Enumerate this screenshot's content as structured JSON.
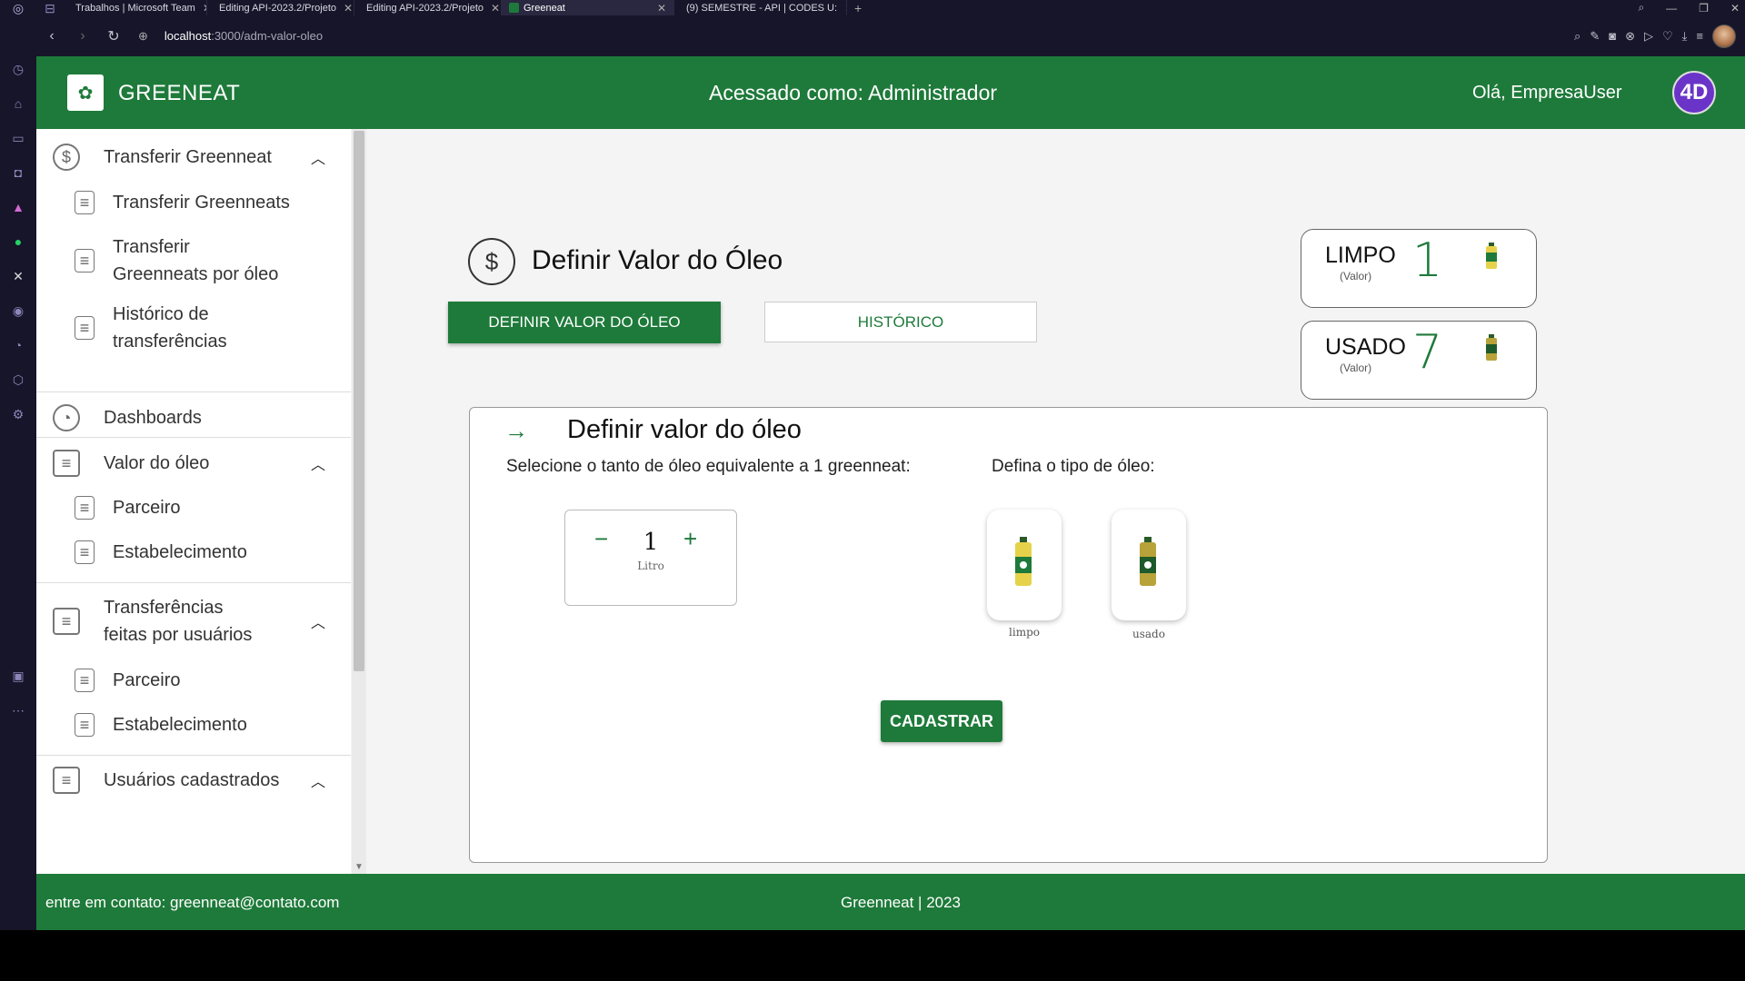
{
  "browser": {
    "tabs": [
      {
        "label": "Trabalhos | Microsoft Team",
        "color": "#5b5fc7"
      },
      {
        "label": "Editing API-2023.2/Projeto",
        "color": "#ffffff"
      },
      {
        "label": "Editing API-2023.2/Projeto",
        "color": "#ffffff"
      },
      {
        "label": "Greeneat",
        "color": "#1e7a3a"
      },
      {
        "label": "(9) SEMESTRE - API | CODES U:",
        "color": "#7b5cff"
      }
    ],
    "url_host": "localhost",
    "url_path": ":3000/adm-valor-oleo"
  },
  "header": {
    "brand": "GREENEAT",
    "access_text": "Acessado como: Administrador",
    "greeting": "Olá, EmpresaUser",
    "avatar_initials": "4D",
    "color": "#1e7a3a"
  },
  "sidebar": {
    "transferir_group": "Transferir Greenneat",
    "transferir_items": [
      "Transferir Greenneats",
      "Transferir Greenneats por óleo",
      "Histórico de transferências"
    ],
    "dashboards": "Dashboards",
    "valor_group": "Valor do óleo",
    "valor_items": [
      "Parceiro",
      "Estabelecimento"
    ],
    "transf_users_group": "Transferências feitas por usuários",
    "transf_users_items": [
      "Parceiro",
      "Estabelecimento"
    ],
    "usuarios_group": "Usuários cadastrados"
  },
  "main": {
    "page_title": "Definir Valor do Óleo",
    "tab_define": "DEFINIR VALOR DO ÓLEO",
    "tab_history": "HISTÓRICO",
    "value_cards": [
      {
        "name": "LIMPO",
        "sub": "(Valor)",
        "value": "1",
        "bottle": "clean"
      },
      {
        "name": "USADO",
        "sub": "(Valor)",
        "value": "7",
        "bottle": "used"
      }
    ],
    "form": {
      "title": "Definir valor do óleo",
      "q_amount": "Selecione o tanto de óleo equivalente a 1 greenneat:",
      "q_type": "Defina o tipo de óleo:",
      "stepper_value": "1",
      "stepper_unit": "Litro",
      "oil_options": [
        "limpo",
        "usado"
      ],
      "submit": "CADASTRAR"
    }
  },
  "footer": {
    "contact": "entre em contato: greenneat@contato.com",
    "copy": "Greenneat | 2023"
  }
}
